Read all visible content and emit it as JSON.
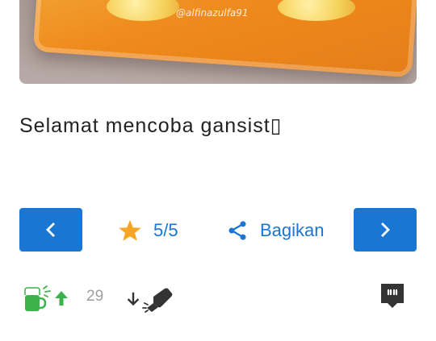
{
  "photo": {
    "watermark": "@alfinazulfa91",
    "colors": {
      "sauce": "#ef8a1c",
      "table": "#b0a29e"
    }
  },
  "caption": "Selamat mencoba gansist▯",
  "navigation": {
    "prev_icon": "chevron-left-icon",
    "next_icon": "chevron-right-icon",
    "button_color": "#1976d2"
  },
  "rating": {
    "value": "5/5",
    "icon": "star-icon",
    "star_color": "#f5a623"
  },
  "share": {
    "label": "Bagikan",
    "icon": "share-icon"
  },
  "reactions": {
    "upvote_count": "29",
    "upvote_color": "#3cb34a",
    "icons": [
      "cooksnap-cup-icon",
      "upvote-arrow-icon",
      "downvote-arrow-icon",
      "eraser-icon",
      "comment-icon"
    ]
  }
}
